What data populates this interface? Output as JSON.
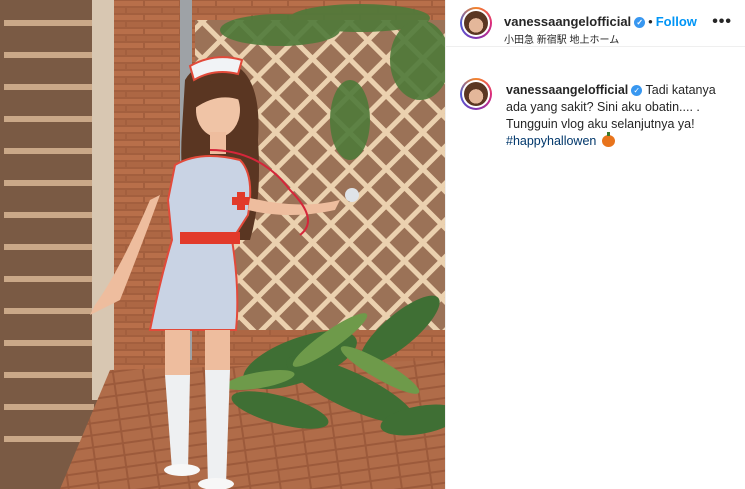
{
  "post": {
    "username": "vanessaangelofficial",
    "verified": true,
    "follow_label": "Follow",
    "location": "小田急 新宿駅 地上ホーム",
    "more_icon": "more-horizontal-icon"
  },
  "caption": {
    "username": "vanessaangelofficial",
    "text": "Tadi katanya ada yang sakit? Sini aku obatin.... . Tungguin vlog aku selanjutnya ya!",
    "hashtag": "#happyhallowen",
    "emoji": "pumpkin-icon"
  },
  "colors": {
    "accent": "#0095f6",
    "verified": "#3897f0",
    "hashtag": "#00376b"
  }
}
